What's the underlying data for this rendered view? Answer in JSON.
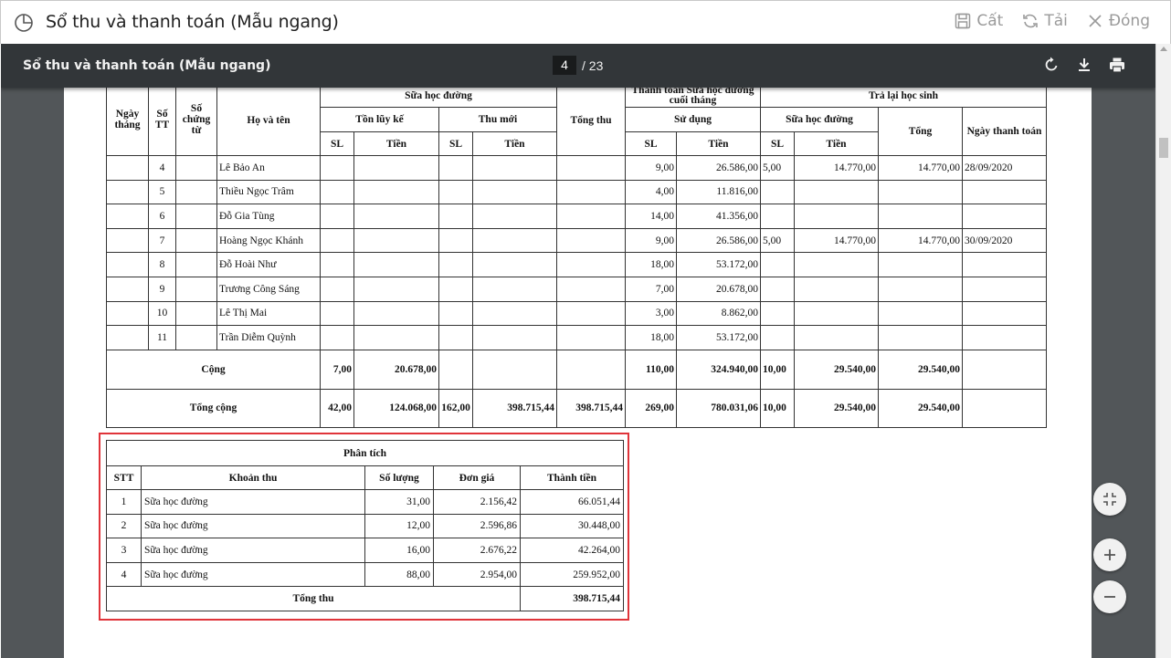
{
  "window": {
    "title": "Sổ thu và thanh toán (Mẫu ngang)",
    "actions": [
      {
        "label": "Cất",
        "icon": "save-icon"
      },
      {
        "label": "Tải",
        "icon": "refresh-icon"
      },
      {
        "label": "Đóng",
        "icon": "close-icon"
      }
    ]
  },
  "pdf_toolbar": {
    "title": "Sổ thu và thanh toán (Mẫu ngang)",
    "current_page": "4",
    "total_pages": "/ 23"
  },
  "ledger": {
    "headers": {
      "ngay_thang": "Ngày tháng",
      "so_tt": "Số TT",
      "so_chung_tu": "Số chứng từ",
      "ho_ten": "Họ và tên",
      "sua_hoc_duong": "Sữa học đường",
      "thanh_toan": "Thanh toán Sữa học đường cuối tháng",
      "tra_lai": "Trả lại học sinh",
      "ton_luy_ke": "Tồn lũy kế",
      "thu_moi": "Thu mới",
      "tong_thu": "Tổng thu",
      "su_dung": "Sử dụng",
      "sua_hoc_duong_2": "Sữa học đường",
      "tong": "Tổng",
      "ngay_thanh_toan": "Ngày thanh toán",
      "sl": "SL",
      "tien": "Tiền"
    },
    "rows": [
      {
        "stt": "4",
        "name": "Lê Bảo An",
        "sd_sl": "9,00",
        "sd_tien": "26.586,00",
        "tl_sl": "5,00",
        "tl_tien": "14.770,00",
        "tl_tong": "14.770,00",
        "ngay_tt": "28/09/2020"
      },
      {
        "stt": "5",
        "name": "Thiều Ngọc Trâm",
        "sd_sl": "4,00",
        "sd_tien": "11.816,00",
        "tl_sl": "",
        "tl_tien": "",
        "tl_tong": "",
        "ngay_tt": ""
      },
      {
        "stt": "6",
        "name": "Đỗ Gia Tùng",
        "sd_sl": "14,00",
        "sd_tien": "41.356,00",
        "tl_sl": "",
        "tl_tien": "",
        "tl_tong": "",
        "ngay_tt": ""
      },
      {
        "stt": "7",
        "name": "Hoàng Ngọc Khánh",
        "sd_sl": "9,00",
        "sd_tien": "26.586,00",
        "tl_sl": "5,00",
        "tl_tien": "14.770,00",
        "tl_tong": "14.770,00",
        "ngay_tt": "30/09/2020"
      },
      {
        "stt": "8",
        "name": "Đỗ Hoài Như",
        "sd_sl": "18,00",
        "sd_tien": "53.172,00",
        "tl_sl": "",
        "tl_tien": "",
        "tl_tong": "",
        "ngay_tt": ""
      },
      {
        "stt": "9",
        "name": "Trương Công Sáng",
        "sd_sl": "7,00",
        "sd_tien": "20.678,00",
        "tl_sl": "",
        "tl_tien": "",
        "tl_tong": "",
        "ngay_tt": ""
      },
      {
        "stt": "10",
        "name": "Lê Thị Mai",
        "sd_sl": "3,00",
        "sd_tien": "8.862,00",
        "tl_sl": "",
        "tl_tien": "",
        "tl_tong": "",
        "ngay_tt": ""
      },
      {
        "stt": "11",
        "name": "Trần Diễm Quỳnh",
        "sd_sl": "18,00",
        "sd_tien": "53.172,00",
        "tl_sl": "",
        "tl_tien": "",
        "tl_tong": "",
        "ngay_tt": ""
      }
    ],
    "cong": {
      "label": "Cộng",
      "ton_sl": "7,00",
      "ton_tien": "20.678,00",
      "sd_sl": "110,00",
      "sd_tien": "324.940,00",
      "tl_sl": "10,00",
      "tl_tien": "29.540,00",
      "tl_tong": "29.540,00"
    },
    "tong_cong": {
      "label": "Tổng cộng",
      "ton_sl": "42,00",
      "ton_tien": "124.068,00",
      "thu_sl": "162,00",
      "thu_tien": "398.715,44",
      "tong_thu": "398.715,44",
      "sd_sl": "269,00",
      "sd_tien": "780.031,06",
      "tl_sl": "10,00",
      "tl_tien": "29.540,00",
      "tl_tong": "29.540,00"
    }
  },
  "analysis": {
    "title": "Phân tích",
    "headers": {
      "stt": "STT",
      "khoan_thu": "Khoản thu",
      "so_luong": "Số lượng",
      "don_gia": "Đơn giá",
      "thanh_tien": "Thành tiền"
    },
    "rows": [
      {
        "stt": "1",
        "khoan_thu": "Sữa học đường",
        "so_luong": "31,00",
        "don_gia": "2.156,42",
        "thanh_tien": "66.051,44"
      },
      {
        "stt": "2",
        "khoan_thu": "Sữa học đường",
        "so_luong": "12,00",
        "don_gia": "2.596,86",
        "thanh_tien": "30.448,00"
      },
      {
        "stt": "3",
        "khoan_thu": "Sữa học đường",
        "so_luong": "16,00",
        "don_gia": "2.676,22",
        "thanh_tien": "42.264,00"
      },
      {
        "stt": "4",
        "khoan_thu": "Sữa học đường",
        "so_luong": "88,00",
        "don_gia": "2.954,00",
        "thanh_tien": "259.952,00"
      }
    ],
    "total_label": "Tổng thu",
    "total_value": "398.715,44"
  },
  "colors": {
    "highlight": "#e0343a",
    "toolbar": "#323639",
    "viewer_bg": "#525659"
  }
}
